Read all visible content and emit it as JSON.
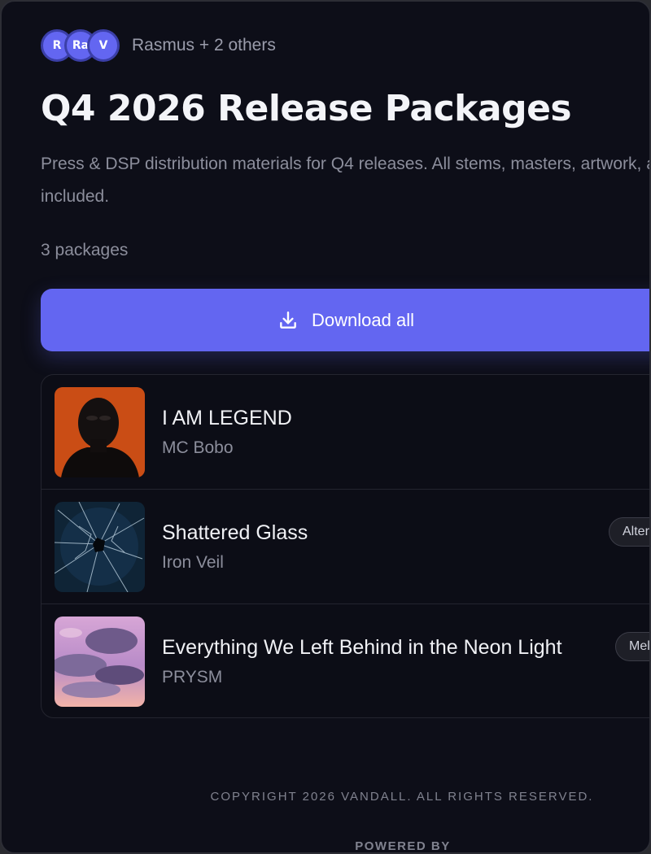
{
  "collaborators": {
    "avatars": [
      "R",
      "Ra",
      "V"
    ],
    "label": "Rasmus + 2 others"
  },
  "page": {
    "title": "Q4 2026 Release Packages",
    "description": "Press & DSP distribution materials for Q4 releases. All stems, masters, artwork, and press kits included.",
    "count": "3 packages"
  },
  "actions": {
    "download_all": "Download all",
    "download_icon": "download-icon"
  },
  "packages": [
    {
      "title": "I AM LEGEND",
      "artist": "MC Bobo",
      "tag": "",
      "artwork": "portrait-orange"
    },
    {
      "title": "Shattered Glass",
      "artist": "Iron Veil",
      "tag": "Alternative",
      "artwork": "shattered-glass"
    },
    {
      "title": "Everything We Left Behind in the Neon Light",
      "artist": "PRYSM",
      "tag": "Melodic",
      "artwork": "pink-clouds"
    }
  ],
  "footer": {
    "copyright": "COPYRIGHT 2026 VANDALL. ALL RIGHTS RESERVED.",
    "powered_by": "POWERED BY"
  },
  "colors": {
    "accent": "#6366f1",
    "background": "#0d0e18"
  }
}
